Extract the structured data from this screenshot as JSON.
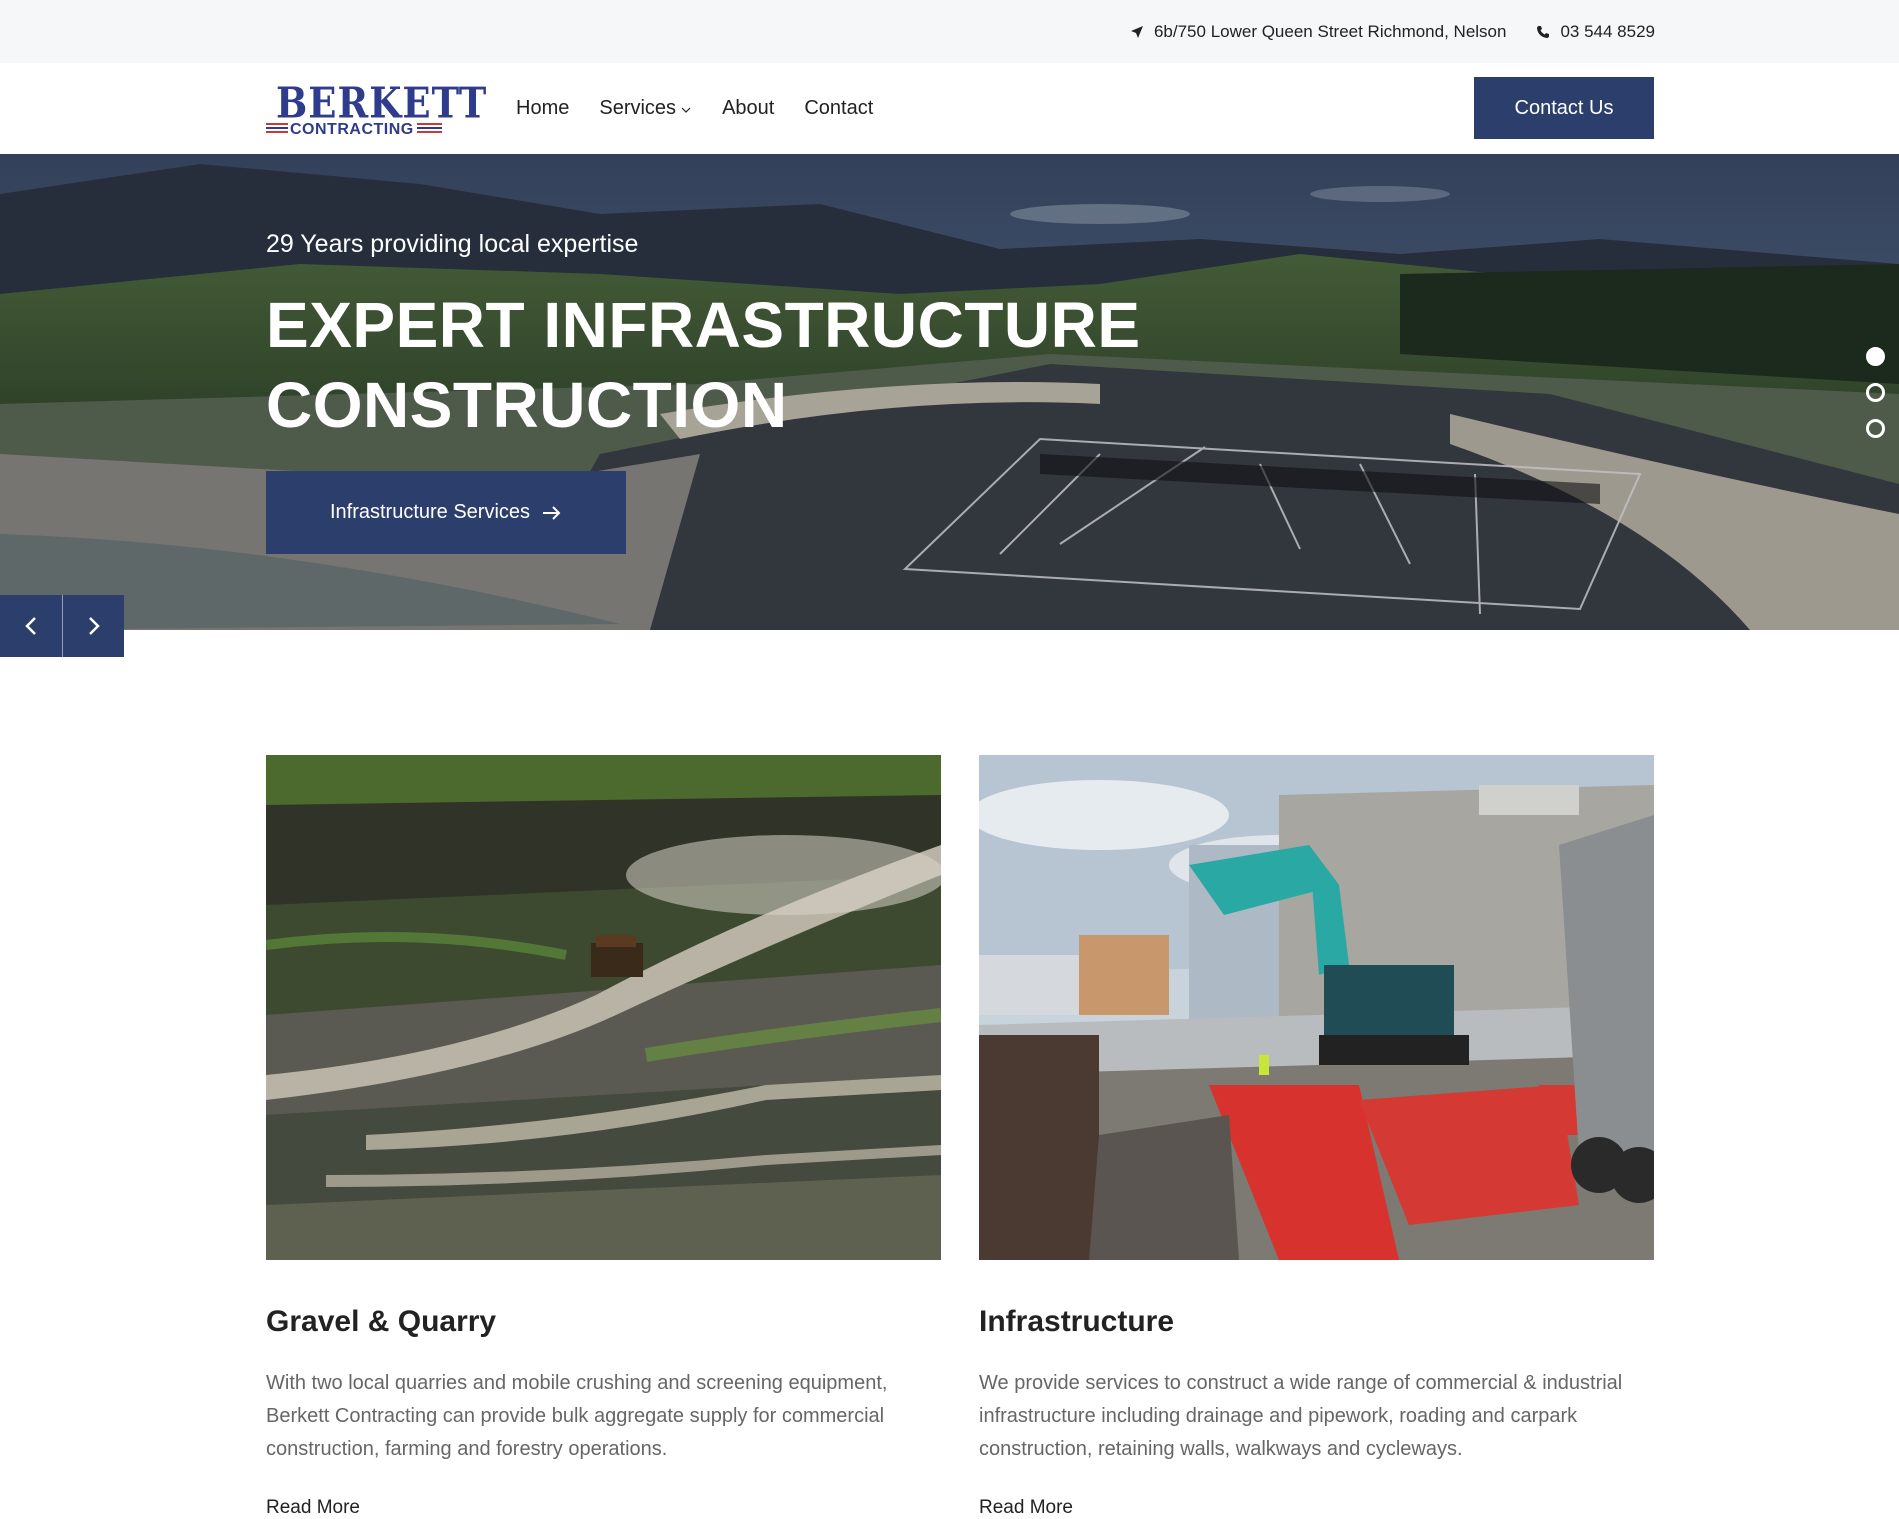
{
  "topbar": {
    "address": "6b/750 Lower Queen Street Richmond, Nelson",
    "phone": "03 544 8529",
    "address_icon": "location-arrow-icon",
    "phone_icon": "phone-icon"
  },
  "header": {
    "logo": {
      "line1": "BERKETT",
      "line2": "CONTRACTING"
    },
    "nav": [
      {
        "label": "Home"
      },
      {
        "label": "Services",
        "has_dropdown": true
      },
      {
        "label": "About"
      },
      {
        "label": "Contact"
      }
    ],
    "cta_label": "Contact Us"
  },
  "hero": {
    "eyebrow": "29 Years providing local expertise",
    "headline_line1": "EXPERT INFRASTRUCTURE",
    "headline_line2": "CONSTRUCTION",
    "button_label": "Infrastructure Services",
    "slides_count": 3,
    "active_slide": 1
  },
  "services": [
    {
      "title": "Gravel & Quarry",
      "description": "With two local quarries and mobile crushing and screening equipment, Berkett Contracting can provide bulk aggregate supply for commercial construction, farming and forestry operations.",
      "link_label": "Read More"
    },
    {
      "title": "Infrastructure",
      "description": "We provide services to construct a wide range of commercial & industrial infrastructure including drainage and pipework, roading and carpark construction, retaining walls, walkways and cycleways.",
      "link_label": "Read More"
    }
  ],
  "colors": {
    "brand_navy": "#2c3e6b",
    "logo_blue": "#2f3b8c",
    "logo_red": "#c73a3a",
    "topbar_bg": "#f6f7f9"
  }
}
